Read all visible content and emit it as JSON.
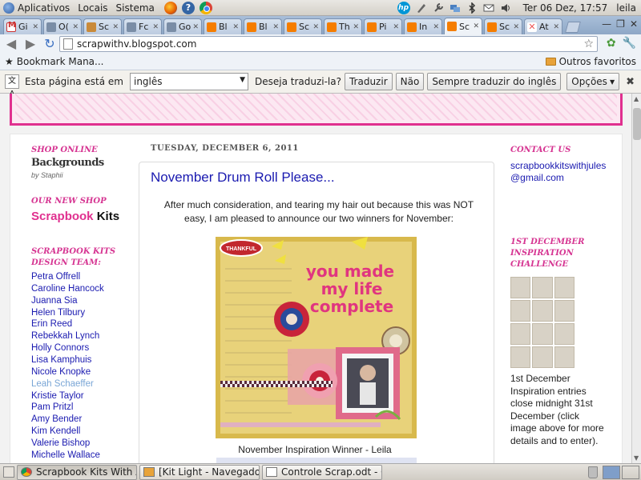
{
  "top_panel": {
    "menus": [
      "Aplicativos",
      "Locais",
      "Sistema"
    ],
    "icons": [
      "ubuntu-icon",
      "firefox-icon",
      "help-icon",
      "chrome-icon"
    ],
    "tray_icons": [
      "hp-icon",
      "pen-icon",
      "tool-icon",
      "network-icon",
      "bluetooth-icon",
      "mail-icon",
      "volume-icon"
    ],
    "clock": "Ter 06 Dez, 17:57",
    "user": "leila"
  },
  "tabs": [
    {
      "label": "Gi",
      "icon": "gmail-icon"
    },
    {
      "label": "O(",
      "icon": "page-icon"
    },
    {
      "label": "Sc",
      "icon": "house-icon"
    },
    {
      "label": "Fc",
      "icon": "page-icon"
    },
    {
      "label": "Go",
      "icon": "page-icon"
    },
    {
      "label": "Bl",
      "icon": "blogger-icon"
    },
    {
      "label": "Bl",
      "icon": "blogger-icon"
    },
    {
      "label": "Sc",
      "icon": "blogger-icon"
    },
    {
      "label": "Th",
      "icon": "blogger-icon"
    },
    {
      "label": "Pi",
      "icon": "blogger-icon"
    },
    {
      "label": "In",
      "icon": "blogger-icon"
    },
    {
      "label": "Sc",
      "icon": "blogger-icon",
      "active": true
    },
    {
      "label": "Sc",
      "icon": "blogger-icon"
    },
    {
      "label": "At",
      "icon": "close-orange-icon"
    }
  ],
  "toolbar": {
    "url": "scrapwithv.blogspot.com"
  },
  "bookmarks": {
    "left_label": "Bookmark Mana...",
    "right_label": "Outros favoritos"
  },
  "translate_bar": {
    "prompt": "Esta página está em",
    "language": "inglês",
    "question": "Deseja traduzi-la?",
    "translate_btn": "Traduzir",
    "no_btn": "Não",
    "always_btn": "Sempre traduzir do inglês",
    "options_btn": "Opções"
  },
  "sidebar_left": {
    "shop_online": "Shop Online",
    "logo1_text": "Backgrounds",
    "logo1_sub": "by Staphii",
    "our_new_shop": "Our New Shop",
    "logo2_a": "Scrapbook",
    "logo2_b": "Kits",
    "team_heading": "Scrapbook Kits Design Team:",
    "team": [
      "Petra Offrell",
      "Caroline Hancock",
      "Juanna Sia",
      "Helen Tilbury",
      "Erin Reed",
      "Rebekkah Lynch",
      "Holly Connors",
      "Lisa Kamphuis",
      "Nicole Knopke",
      "Leah Schaeffer",
      "Kristie Taylor",
      "Pam Pritzl",
      "Amy Bender",
      "Kim Kendell",
      "Valerie Bishop",
      "Michelle Wallace"
    ]
  },
  "post": {
    "date": "TUESDAY, DECEMBER 6, 2011",
    "title": "November Drum Roll Please...",
    "body": "After much consideration, and tearing my hair out because this was NOT easy, I am pleased to announce our two winners for November:",
    "image_text_1": "THANKFUL",
    "image_text_2": "you made",
    "image_text_3": "my life",
    "image_text_4": "complete",
    "caption": "November Inspiration Winner - Leila"
  },
  "sidebar_right": {
    "contact_heading": "Contact Us",
    "email": "scrapbookkitswithjules @gmail.com",
    "challenge_heading": "1st December Inspiration Challenge",
    "challenge_text": "1st December Inspiration entries close midnight 31st December (click image above for more details and to enter)."
  },
  "taskbar": {
    "items": [
      {
        "label": "Scrapbook Kits With A ...",
        "icon": "chrome-icon",
        "active": true
      },
      {
        "label": "[Kit Light - Navegador ...",
        "icon": "folder-icon",
        "active": false
      },
      {
        "label": "Controle Scrap.odt - O...",
        "icon": "document-icon",
        "active": false
      }
    ]
  }
}
